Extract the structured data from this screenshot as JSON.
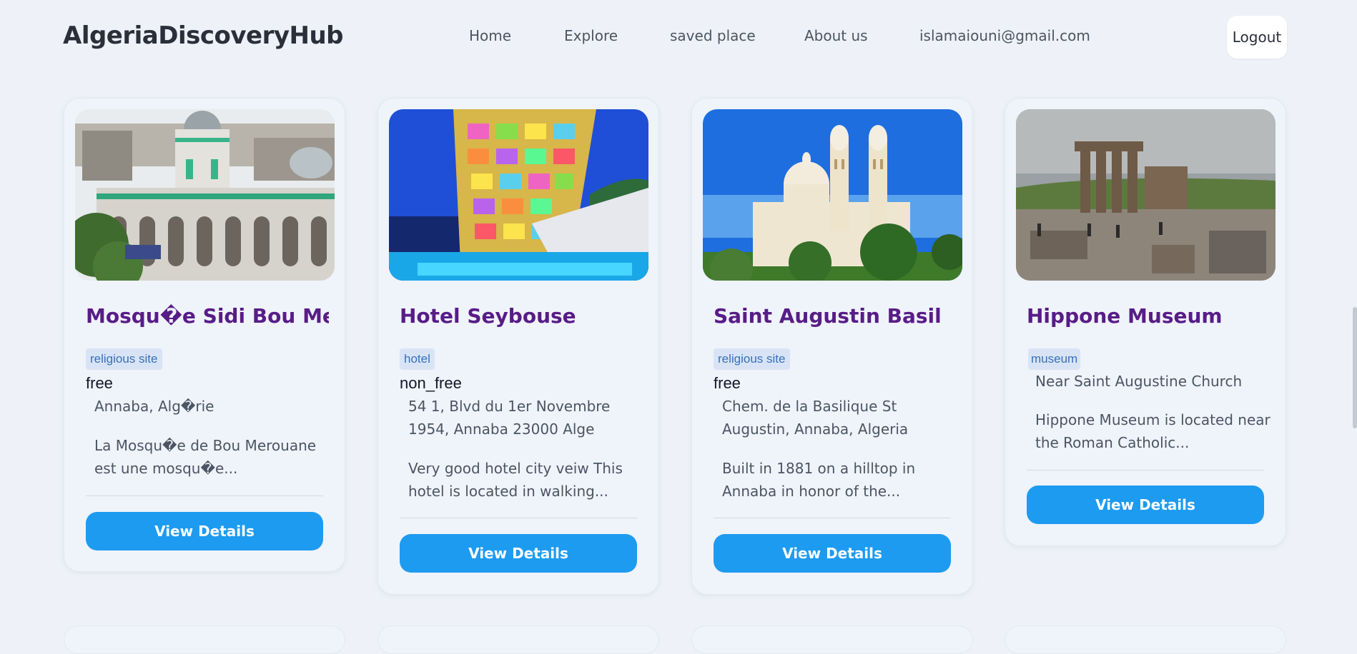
{
  "header": {
    "logo": "AlgeriaDiscoveryHub",
    "nav": [
      "Home",
      "Explore",
      "saved place",
      "About us",
      "islamaiouni@gmail.com"
    ],
    "logout_label": "Logout"
  },
  "places": [
    {
      "title": "Mosqu�e Sidi Bou Mer",
      "category": "religious site",
      "price": "free",
      "address": "Annaba, Alg�rie",
      "description": "La Mosqu�e de Bou Merouane est une mosqu�e...",
      "button": "View Details",
      "image": "mosque-photo"
    },
    {
      "title": "Hotel Seybouse",
      "category": "hotel",
      "price": "non_free",
      "address": "54 1, Blvd du 1er Novembre 1954, Annaba 23000 Alge",
      "description": "Very good hotel city veiw This hotel is located in walking...",
      "button": "View Details",
      "image": "hotel-photo"
    },
    {
      "title": "Saint Augustin Basil",
      "category": "religious site",
      "price": "free",
      "address": "Chem. de la Basilique St Augustin, Annaba, Algeria",
      "description": "Built in 1881 on a hilltop in Annaba in honor of the...",
      "button": "View Details",
      "image": "basilica-photo"
    },
    {
      "title": "Hippone Museum",
      "category": "museum",
      "price": "",
      "address": "Near Saint Augustine Church",
      "description": "Hippone Museum is located near the Roman Catholic...",
      "button": "View Details",
      "image": "ruins-photo"
    }
  ],
  "colors": {
    "background": "#eef2f8",
    "title": "#581c87",
    "accent_button": "#1d9bf0",
    "badge_bg": "#d8e4f6",
    "badge_text": "#3a6fb8"
  }
}
